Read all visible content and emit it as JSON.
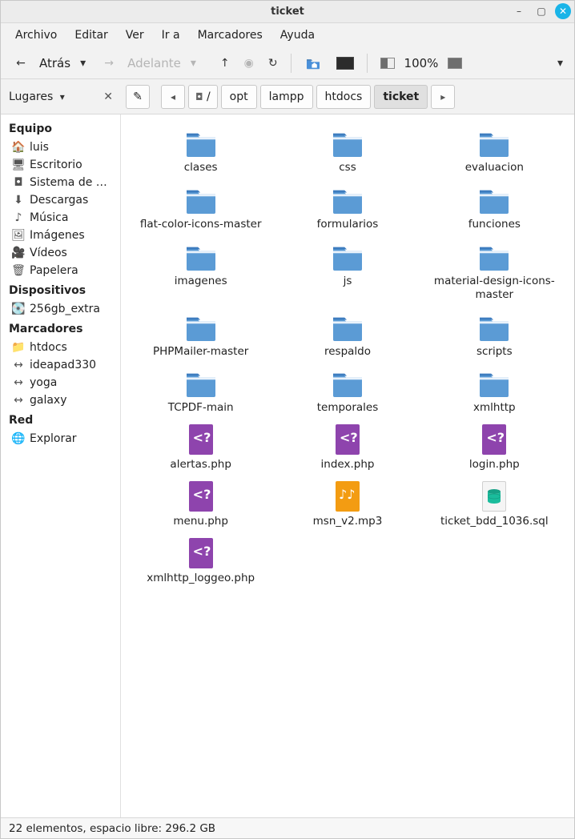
{
  "window": {
    "title": "ticket"
  },
  "menubar": [
    "Archivo",
    "Editar",
    "Ver",
    "Ir a",
    "Marcadores",
    "Ayuda"
  ],
  "toolbar": {
    "back_label": "Atrás",
    "forward_label": "Adelante",
    "zoom_label": "100%"
  },
  "places": {
    "header": "Lugares",
    "sections": [
      {
        "title": "Equipo",
        "items": [
          {
            "label": "luis",
            "icon": "home"
          },
          {
            "label": "Escritorio",
            "icon": "desktop"
          },
          {
            "label": "Sistema de …",
            "icon": "disk"
          },
          {
            "label": "Descargas",
            "icon": "download"
          },
          {
            "label": "Música",
            "icon": "music"
          },
          {
            "label": "Imágenes",
            "icon": "pictures"
          },
          {
            "label": "Vídeos",
            "icon": "video"
          },
          {
            "label": "Papelera",
            "icon": "trash"
          }
        ]
      },
      {
        "title": "Dispositivos",
        "items": [
          {
            "label": "256gb_extra",
            "icon": "drive"
          }
        ]
      },
      {
        "title": "Marcadores",
        "items": [
          {
            "label": "htdocs",
            "icon": "folder"
          },
          {
            "label": "ideapad330",
            "icon": "net"
          },
          {
            "label": "yoga",
            "icon": "net"
          },
          {
            "label": "galaxy",
            "icon": "net"
          }
        ]
      },
      {
        "title": "Red",
        "items": [
          {
            "label": "Explorar",
            "icon": "globe"
          }
        ]
      }
    ]
  },
  "breadcrumb": {
    "root": "/",
    "segments": [
      "opt",
      "lampp",
      "htdocs",
      "ticket"
    ],
    "current_index": 3
  },
  "files": [
    {
      "name": "clases",
      "type": "folder"
    },
    {
      "name": "css",
      "type": "folder"
    },
    {
      "name": "evaluacion",
      "type": "folder"
    },
    {
      "name": "flat-color-icons-master",
      "type": "folder"
    },
    {
      "name": "formularios",
      "type": "folder"
    },
    {
      "name": "funciones",
      "type": "folder"
    },
    {
      "name": "imagenes",
      "type": "folder"
    },
    {
      "name": "js",
      "type": "folder"
    },
    {
      "name": "material-design-icons-master",
      "type": "folder"
    },
    {
      "name": "PHPMailer-master",
      "type": "folder"
    },
    {
      "name": "respaldo",
      "type": "folder"
    },
    {
      "name": "scripts",
      "type": "folder"
    },
    {
      "name": "TCPDF-main",
      "type": "folder"
    },
    {
      "name": "temporales",
      "type": "folder"
    },
    {
      "name": "xmlhttp",
      "type": "folder"
    },
    {
      "name": "alertas.php",
      "type": "php"
    },
    {
      "name": "index.php",
      "type": "php"
    },
    {
      "name": "login.php",
      "type": "php"
    },
    {
      "name": "menu.php",
      "type": "php"
    },
    {
      "name": "msn_v2.mp3",
      "type": "audio"
    },
    {
      "name": "ticket_bdd_1036.sql",
      "type": "sql"
    },
    {
      "name": "xmlhttp_loggeo.php",
      "type": "php"
    }
  ],
  "statusbar": {
    "text": "22 elementos, espacio libre: 296.2 GB"
  }
}
